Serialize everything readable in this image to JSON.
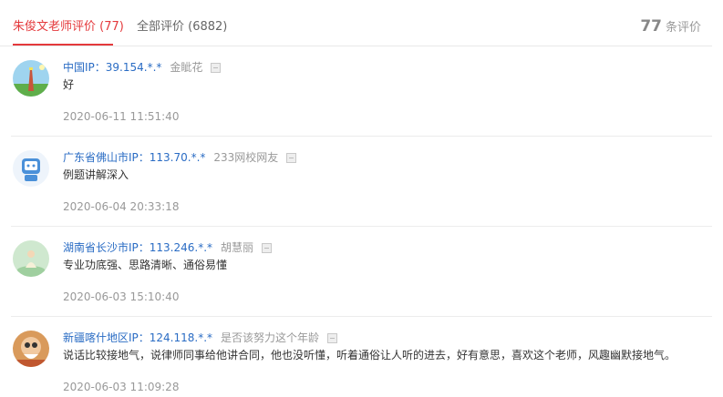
{
  "tabs": {
    "teacher_label": "朱俊文老师评价 (77)",
    "all_label": "全部评价 (6882)",
    "total_count": "77",
    "total_suffix": "条评价"
  },
  "reviews": [
    {
      "ip": "中国IP：39.154.*.*",
      "user": "金眦花",
      "content": "好",
      "time": "2020-06-11 11:51:40",
      "avatar": "lighthouse-avatar"
    },
    {
      "ip": "广东省佛山市IP：113.70.*.*",
      "user": "233网校网友",
      "content": "例题讲解深入",
      "time": "2020-06-04 20:33:18",
      "avatar": "robot-avatar"
    },
    {
      "ip": "湖南省长沙市IP：113.246.*.*",
      "user": "胡慧丽",
      "content": "专业功底强、思路清晰、通俗易懂",
      "time": "2020-06-03 15:10:40",
      "avatar": "sitting-person-avatar"
    },
    {
      "ip": "新疆喀什地区IP：124.118.*.*",
      "user": "是否该努力这个年龄",
      "content": "说话比较接地气，说律师同事给他讲合同，他也没听懂，听着通俗让人听的进去，好有意思，喜欢这个老师，风趣幽默接地气。",
      "time": "2020-06-03 11:09:28",
      "avatar": "cartoon-character-avatar"
    }
  ]
}
